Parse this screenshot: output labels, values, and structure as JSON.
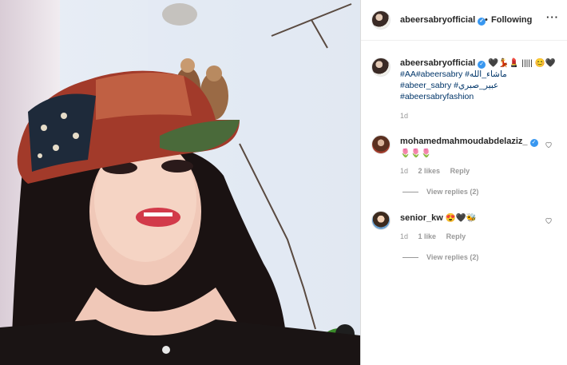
{
  "post": {
    "author": "abeersabryofficial",
    "separator": "•",
    "follow_status": "Following",
    "more_label": "···"
  },
  "caption": {
    "username": "abeersabryofficial",
    "text_after_name": "🖤💃💄 ||||| 😊🖤",
    "line2": "#AA#abeersabry #ماشاء_الله",
    "line3": "#abeer_sabry #عبير_صبري",
    "line4": "#abeersabryfashion",
    "time": "1d"
  },
  "comments": [
    {
      "username": "mohamedmahmoudabdelaziz_",
      "verified": true,
      "text": "🌷🌷🌷",
      "time": "1d",
      "likes": "2 likes",
      "reply": "Reply",
      "view_replies": "View replies (2)"
    },
    {
      "username": "senior_kw",
      "verified": false,
      "text": "😍🖤🐝",
      "time": "1d",
      "likes": "1 like",
      "reply": "Reply",
      "view_replies": "View replies (2)"
    }
  ],
  "colors": {
    "link": "#003569",
    "verified": "#3897f0",
    "muted": "#999999"
  },
  "icons": [
    "verified-badge-icon",
    "heart-icon",
    "more-options-icon"
  ]
}
